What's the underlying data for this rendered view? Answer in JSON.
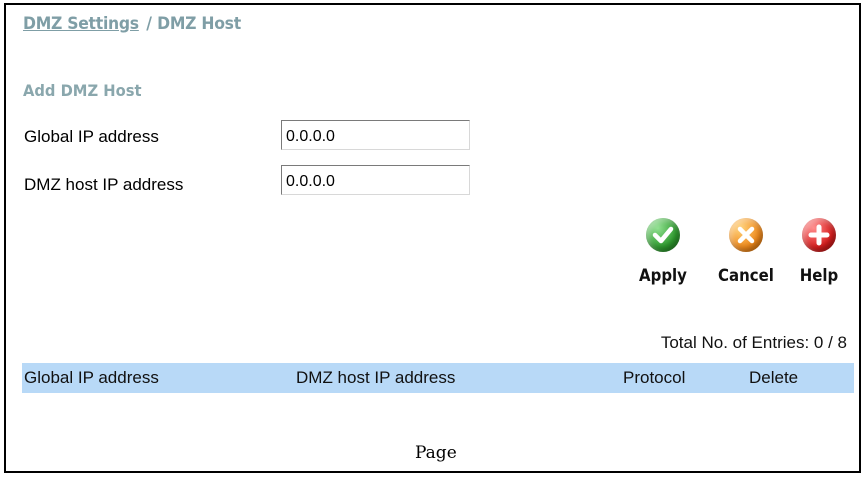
{
  "breadcrumb": {
    "parent": "DMZ Settings",
    "separator": "/",
    "current": "DMZ Host"
  },
  "form": {
    "section_title": "Add DMZ Host",
    "global_ip_label": "Global IP address",
    "global_ip_value": "0.0.0.0",
    "dmz_ip_label": "DMZ host IP address",
    "dmz_ip_value": "0.0.0.0"
  },
  "actions": {
    "apply_label": "Apply",
    "cancel_label": "Cancel",
    "help_label": "Help",
    "apply_icon": "check-circle-icon",
    "cancel_icon": "x-circle-icon",
    "help_icon": "plus-circle-icon",
    "apply_color": "#2e9a2e",
    "cancel_color": "#f08a1c",
    "help_color": "#d81e1e"
  },
  "table": {
    "total_entries": "Total No. of Entries: 0 / 8",
    "columns": [
      "Global IP address",
      "DMZ host IP address",
      "Protocol",
      "Delete"
    ],
    "header_bg": "#b8d9f7",
    "rows": []
  },
  "pager": {
    "label": "Page"
  }
}
